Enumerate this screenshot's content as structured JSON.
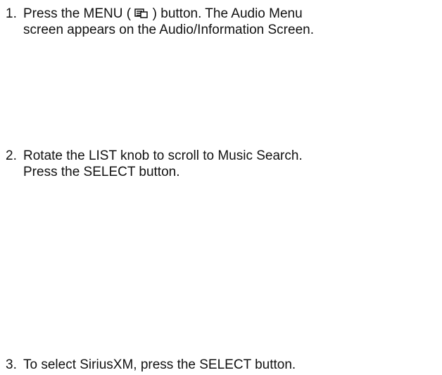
{
  "steps": [
    {
      "number": "1.",
      "line1_before_icon": "Press the MENU ( ",
      "icon": "menu-icon",
      "line1_after_icon": " ) button. The Audio Menu",
      "line2": "screen appears on the Audio/Information Screen."
    },
    {
      "number": "2.",
      "line1": "Rotate the LIST knob to scroll to Music Search.",
      "line2": "Press the SELECT button."
    },
    {
      "number": "3.",
      "line1": "To select SiriusXM, press the SELECT button."
    }
  ]
}
